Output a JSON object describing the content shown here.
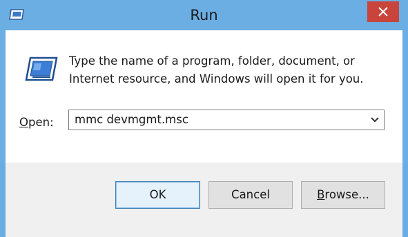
{
  "window": {
    "title": "Run",
    "app_icon": "run-dialog-icon",
    "close_icon": "close-icon"
  },
  "dialog": {
    "description_line1": "Type the name of a program, folder, document, or",
    "description_line2": "Internet resource, and Windows will open it for you.",
    "open_label_accel": "O",
    "open_label_rest": "pen:",
    "open_value": "mmc devmgmt.msc"
  },
  "buttons": {
    "ok": "OK",
    "cancel": "Cancel",
    "browse_accel": "B",
    "browse_rest": "rowse..."
  },
  "colors": {
    "frame": "#6aaee4",
    "close_button": "#c9443a",
    "ok_border": "#3c7fb1"
  }
}
